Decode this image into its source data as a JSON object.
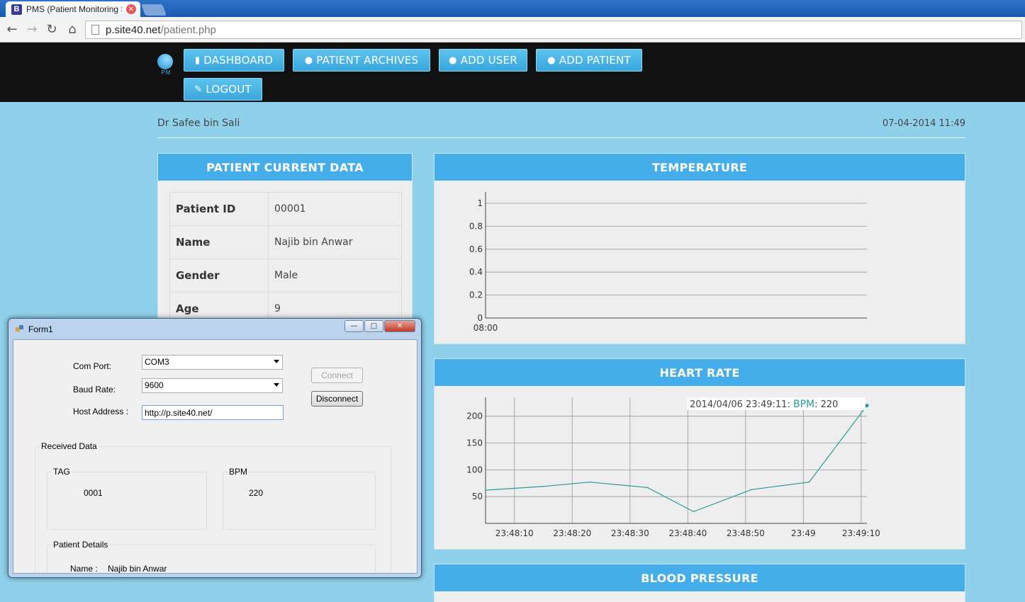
{
  "browser": {
    "tab_favicon": "B",
    "tab_title": "PMS (Patient Monitoring S",
    "url_host": "p.site40.net",
    "url_path": "/patient.php"
  },
  "nav": {
    "logo_text": "P.M",
    "buttons": [
      {
        "label": "DASHBOARD",
        "icon": "bar-chart-icon"
      },
      {
        "label": "PATIENT ARCHIVES",
        "icon": "user-icon"
      },
      {
        "label": "ADD USER",
        "icon": "user-icon"
      },
      {
        "label": "ADD PATIENT",
        "icon": "user-icon"
      },
      {
        "label": "LOGOUT",
        "icon": "pencil-icon"
      }
    ]
  },
  "header": {
    "doctor": "Dr Safee bin Sali",
    "datetime": "07-04-2014 11:49"
  },
  "patient_panel": {
    "title": "PATIENT CURRENT DATA",
    "rows": [
      {
        "key": "Patient ID",
        "value": "00001"
      },
      {
        "key": "Name",
        "value": "Najib bin Anwar"
      },
      {
        "key": "Gender",
        "value": "Male"
      },
      {
        "key": "Age",
        "value": "9"
      }
    ]
  },
  "temperature_panel": {
    "title": "TEMPERATURE"
  },
  "heart_panel": {
    "title": "HEART RATE",
    "tooltip_time": "2014/04/06 23:49:11:",
    "tooltip_label": "BPM",
    "tooltip_value": ": 220"
  },
  "bp_panel": {
    "title": "BLOOD PRESSURE"
  },
  "chart_data": [
    {
      "type": "line",
      "title": "TEMPERATURE",
      "x": [
        "08:00"
      ],
      "series": [],
      "yticks": [
        "0",
        "0.2",
        "0.4",
        "0.6",
        "0.8",
        "1"
      ],
      "ylim": [
        0,
        1
      ],
      "grid": true
    },
    {
      "type": "line",
      "title": "HEART RATE",
      "x": [
        "23:48:05",
        "23:48:15",
        "23:48:23",
        "23:48:33",
        "23:48:41",
        "23:48:51",
        "23:49:01",
        "23:49:11"
      ],
      "xticks": [
        "23:48:10",
        "23:48:20",
        "23:48:30",
        "23:48:40",
        "23:48:50",
        "23:49",
        "23:49:10"
      ],
      "series": [
        {
          "values": [
            62,
            69,
            77,
            67,
            22,
            63,
            77,
            220
          ]
        }
      ],
      "yticks": [
        "50",
        "100",
        "150",
        "200"
      ],
      "ylim": [
        0,
        230
      ],
      "grid": true,
      "line_color": "#2a9a95"
    }
  ],
  "form": {
    "title": "Form1",
    "com_port_label": "Com Port:",
    "com_port_value": "COM3",
    "baud_label": "Baud Rate:",
    "baud_value": "9600",
    "host_label": "Host Address :",
    "host_value": "http://p.site40.net/",
    "connect_label": "Connect",
    "disconnect_label": "Disconnect",
    "received_label": "Received Data",
    "tag_label": "TAG",
    "tag_value": "0001",
    "bpm_label": "BPM",
    "bpm_value": "220",
    "details_label": "Patient Details",
    "name_label": "Name :",
    "name_value": "Najib bin Anwar"
  }
}
